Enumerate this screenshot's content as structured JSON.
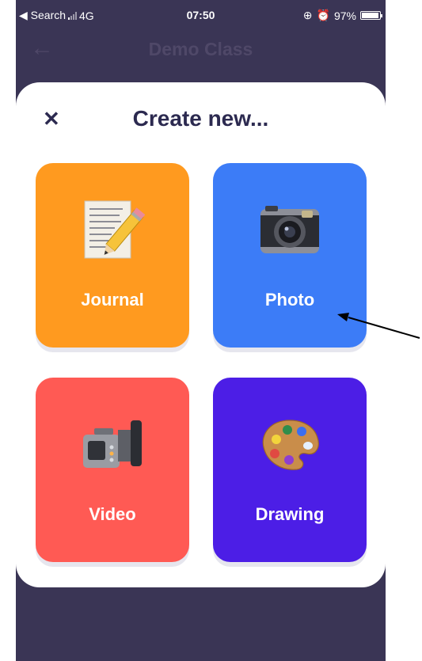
{
  "status": {
    "carrier": "◀ Search",
    "network": "4G",
    "time": "07:50",
    "battery": "97%",
    "battery_level": 0.97
  },
  "nav": {
    "back_icon": "arrow-left-icon",
    "title": "Demo Class"
  },
  "sheet": {
    "close_label": "✕",
    "title": "Create new..."
  },
  "tiles": [
    {
      "label": "Journal",
      "color": "#ff9a1f",
      "icon": "journal-icon"
    },
    {
      "label": "Photo",
      "color": "#3c7cf7",
      "icon": "camera-icon"
    },
    {
      "label": "Video",
      "color": "#ff5a54",
      "icon": "video-camera-icon"
    },
    {
      "label": "Drawing",
      "color": "#4c1ee6",
      "icon": "palette-icon"
    }
  ],
  "colors": {
    "background": "#3a3555",
    "sheet": "#ffffff",
    "title": "#2c2a50"
  }
}
